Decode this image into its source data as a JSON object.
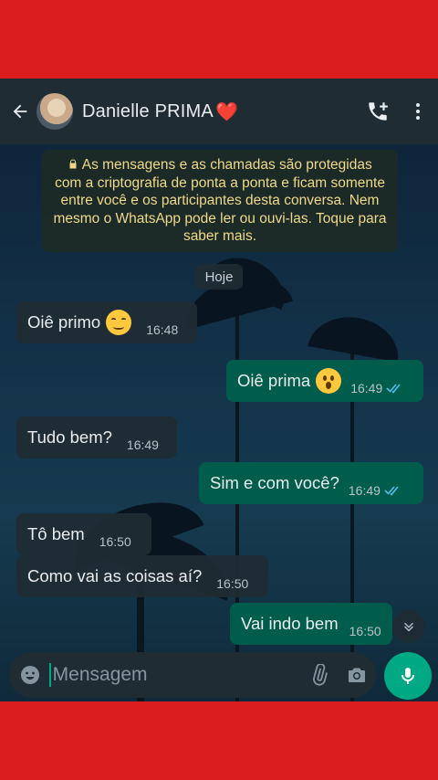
{
  "header": {
    "contact_name": "Danielle PRIMA",
    "name_emoji": "❤️"
  },
  "encryption_notice": "As mensagens e as chamadas são protegidas com a criptografia de ponta a ponta e ficam somente entre você e os participantes desta conversa. Nem mesmo o WhatsApp pode ler ou ouvi-las. Toque para saber mais.",
  "date_chip": "Hoje",
  "messages": [
    {
      "direction": "in",
      "text": "Oiê primo",
      "emoji": "smiling-face",
      "time": "16:48"
    },
    {
      "direction": "out",
      "text": "Oiê prima",
      "emoji": "surprised-face",
      "time": "16:49",
      "status": "read"
    },
    {
      "direction": "in",
      "text": "Tudo bem?",
      "time": "16:49"
    },
    {
      "direction": "out",
      "text": "Sim e com você?",
      "time": "16:49",
      "status": "read"
    },
    {
      "direction": "in",
      "text": "Tô bem",
      "time": "16:50"
    },
    {
      "direction": "in",
      "text": "Como vai as coisas aí?",
      "time": "16:50"
    },
    {
      "direction": "out",
      "text": "Vai indo bem",
      "time": "16:50"
    }
  ],
  "composer": {
    "placeholder": "Mensagem"
  },
  "colors": {
    "frame_red": "#d91c1c",
    "header_bg": "#1f2c34",
    "outgoing_bubble": "#005c4b",
    "incoming_bubble": "#1f2c34",
    "accent_green": "#00a884",
    "read_ticks": "#53bdeb"
  }
}
